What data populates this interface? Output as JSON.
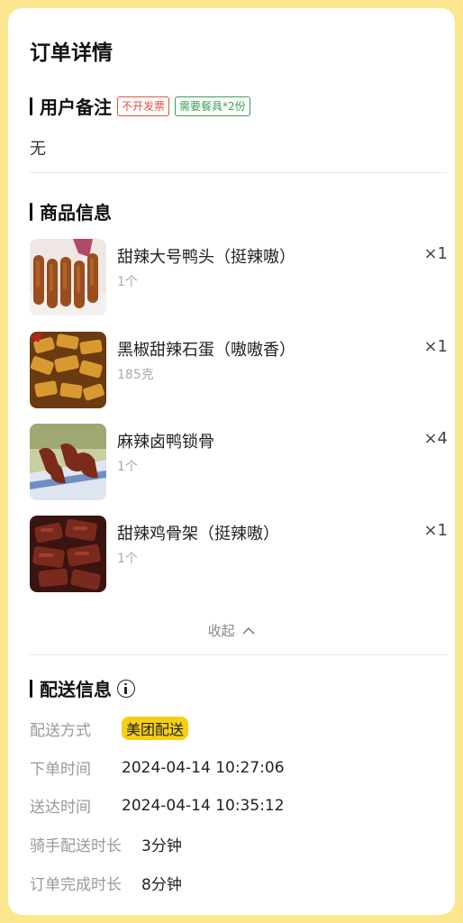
{
  "header": {
    "title": "订单详情"
  },
  "remark": {
    "title": "用户备注",
    "tags": [
      "不开发票",
      "需要餐具*2份"
    ],
    "content": "无"
  },
  "goods": {
    "title": "商品信息",
    "items": [
      {
        "name": "甜辣大号鸭头（挺辣嗷）",
        "spec": "1个",
        "qty": "×1",
        "image": "duck-head-photo"
      },
      {
        "name": "黑椒甜辣石蛋（嗷嗷香）",
        "spec": "185克",
        "qty": "×1",
        "image": "stone-egg-photo"
      },
      {
        "name": "麻辣卤鸭锁骨",
        "spec": "1个",
        "qty": "×4",
        "image": "duck-clavicle-photo"
      },
      {
        "name": "甜辣鸡骨架（挺辣嗷）",
        "spec": "1个",
        "qty": "×1",
        "image": "chicken-frame-photo"
      }
    ],
    "collapse_label": "收起"
  },
  "delivery": {
    "title": "配送信息",
    "method_label": "配送方式",
    "method_value": "美团配送",
    "order_time_label": "下单时间",
    "order_time": "2024-04-14 10:27:06",
    "arrive_time_label": "送达时间",
    "arrive_time": "2024-04-14 10:35:12",
    "rider_duration_label": "骑手配送时长",
    "rider_duration": "3分钟",
    "complete_duration_label": "订单完成时长",
    "complete_duration": "8分钟"
  },
  "colors": {
    "background": "#fbe78f",
    "badge": "#f5cf15",
    "tag_red": "#e5533c",
    "tag_green": "#3aa055"
  }
}
